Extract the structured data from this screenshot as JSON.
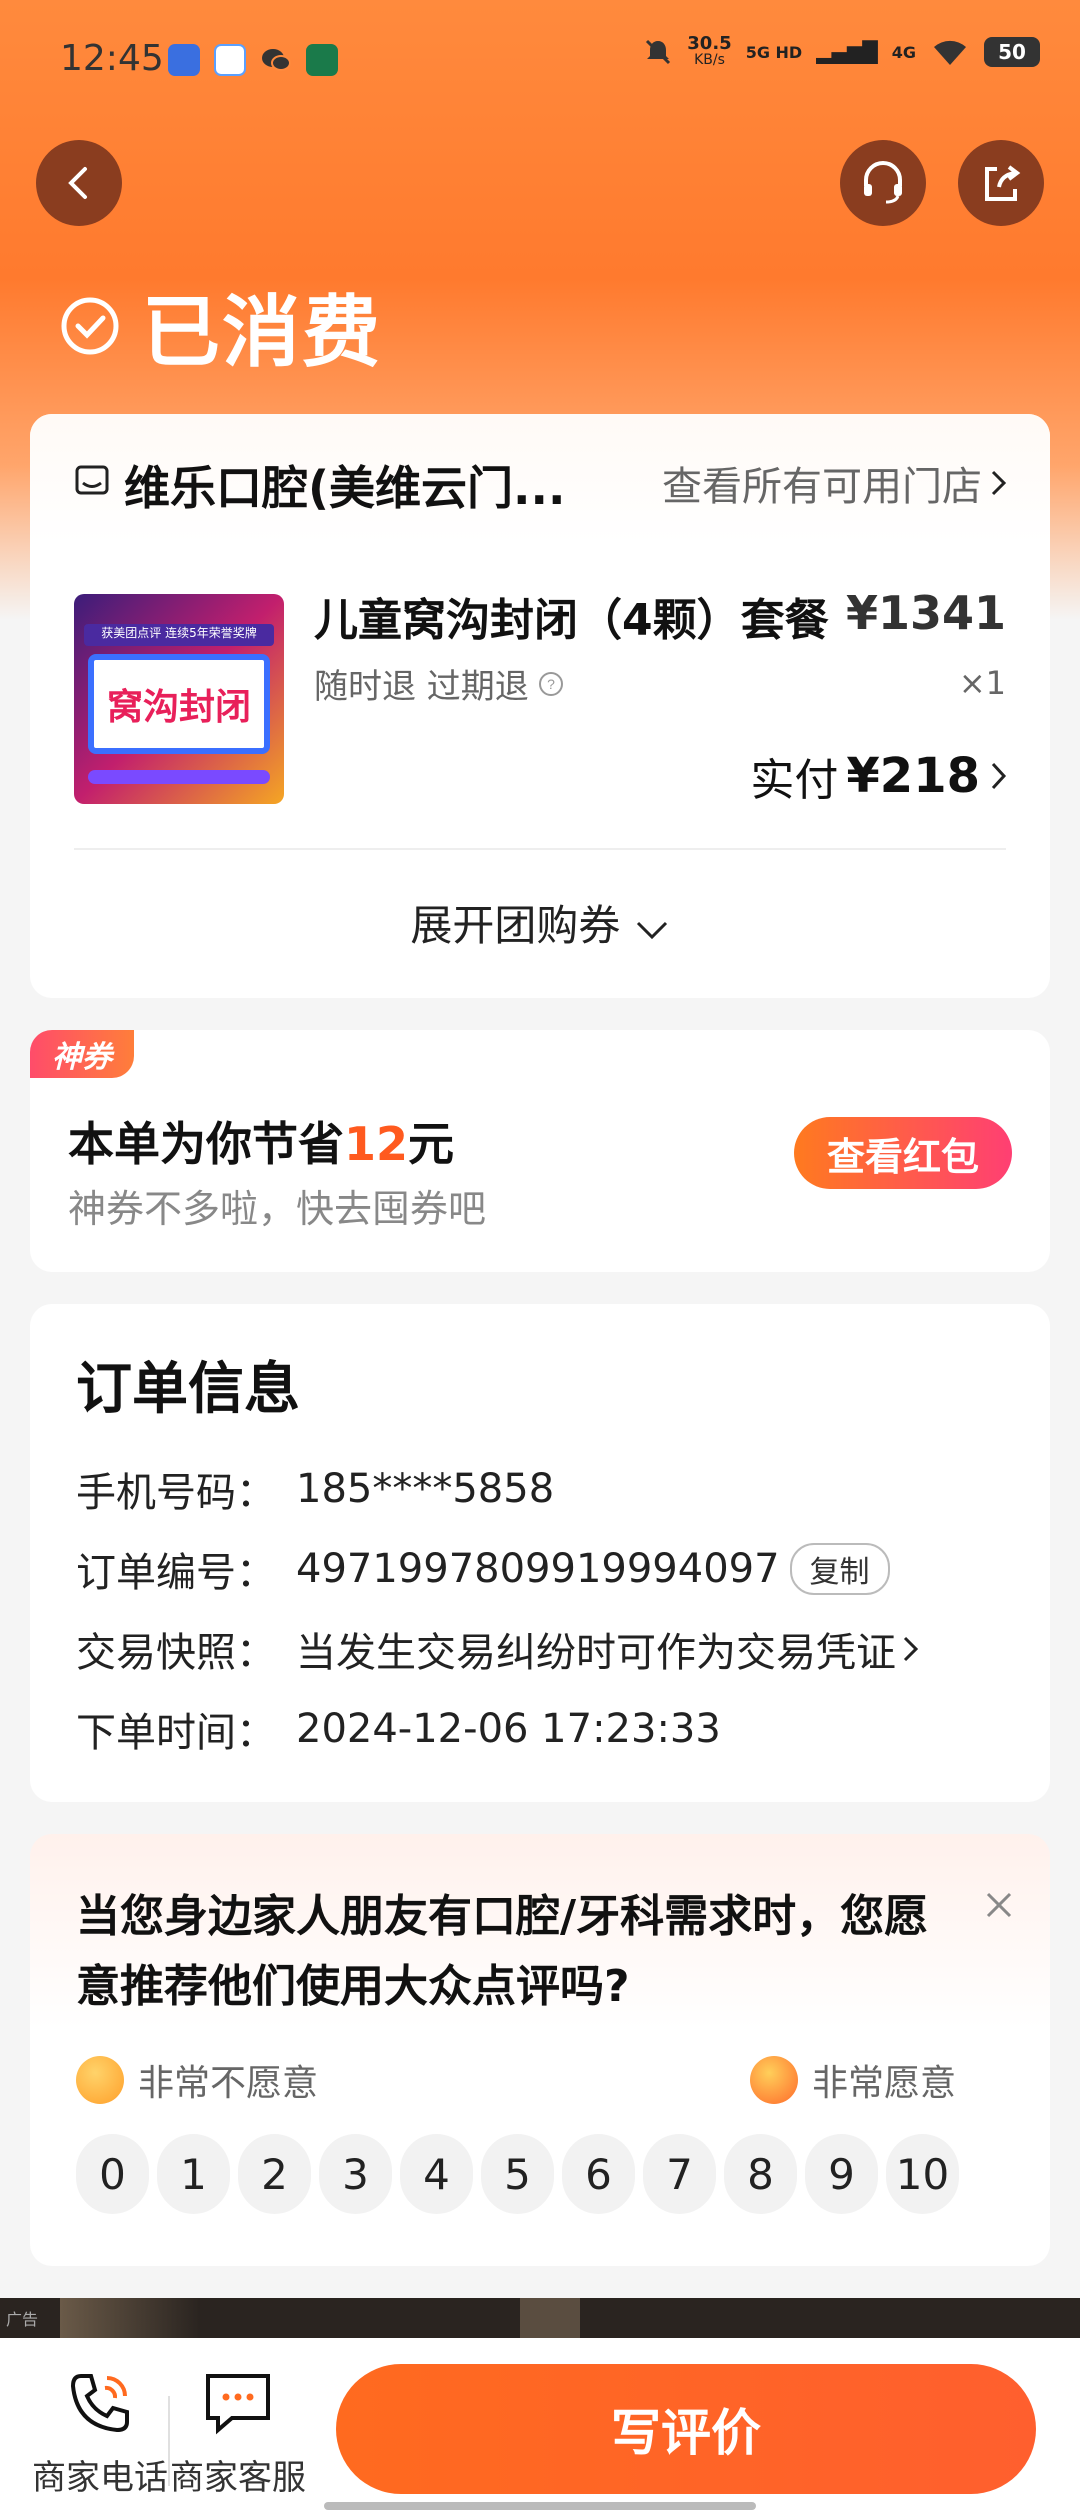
{
  "status_bar": {
    "time": "12:45",
    "speed": "30.5",
    "speed_unit": "KB/s",
    "net1": "5G HD",
    "net2": "4G",
    "battery": "50"
  },
  "header": {
    "status_label": "已消费"
  },
  "store": {
    "name": "维乐口腔(美维云门...",
    "all_stores_link": "查看所有可用门店"
  },
  "product": {
    "thumb_text": "窝沟封闭",
    "thumb_banner": "获美团点评 连续5年荣誉奖牌",
    "title": "儿童窝沟封闭（4颗）套餐",
    "price": "¥1341",
    "tags": "随时退 过期退",
    "qty": "×1",
    "paid_label": "实付",
    "paid_amount": "¥218",
    "expand_label": "展开团购券"
  },
  "voucher": {
    "tag": "神券",
    "save_prefix": "本单为你节省",
    "save_amount": "12",
    "save_suffix": "元",
    "sub": "神券不多啦，快去囤券吧",
    "button": "查看红包"
  },
  "order": {
    "title": "订单信息",
    "rows": [
      {
        "label": "手机号码：",
        "value": "185****5858"
      },
      {
        "label": "订单编号：",
        "value": "4971997809919994097"
      },
      {
        "label": "交易快照：",
        "value": "当发生交易纠纷时可作为交易凭证"
      },
      {
        "label": "下单时间：",
        "value": "2024-12-06 17:23:33"
      }
    ],
    "copy_label": "复制"
  },
  "survey": {
    "question": "当您身边家人朋友有口腔/牙科需求时，您愿意推荐他们使用大众点评吗?",
    "low_label": "非常不愿意",
    "high_label": "非常愿意",
    "scale": [
      "0",
      "1",
      "2",
      "3",
      "4",
      "5",
      "6",
      "7",
      "8",
      "9",
      "10"
    ]
  },
  "ad": {
    "label": "广告"
  },
  "bottom": {
    "phone_label": "商家电话",
    "service_label": "商家客服",
    "review_button": "写评价"
  },
  "colors": {
    "accent": "#ff6a1f",
    "price_highlight": "#ff5a1f"
  }
}
